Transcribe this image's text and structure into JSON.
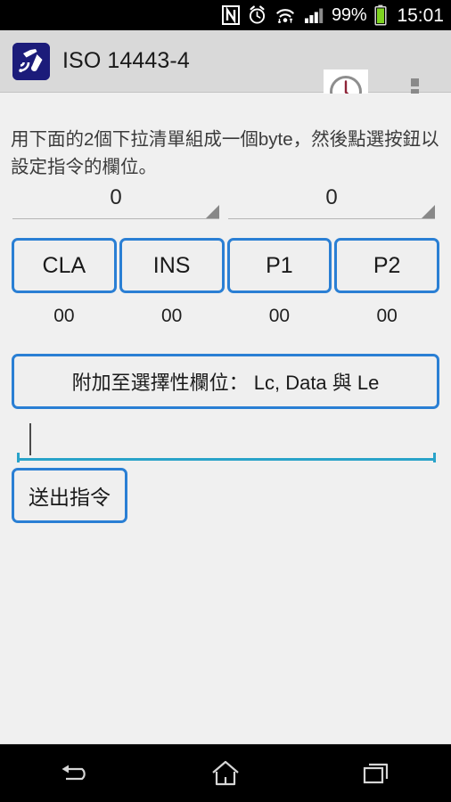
{
  "status_bar": {
    "icons": [
      "nfc-icon",
      "alarm-icon",
      "wifi-icon",
      "signal-icon",
      "battery-icon"
    ],
    "battery_percent": "99%",
    "clock": "15:01"
  },
  "app_bar": {
    "app_icon_name": "nfc-tools-app-icon",
    "title": "ISO 14443-4",
    "clock_action_name": "clock-icon",
    "overflow_name": "overflow-menu-icon"
  },
  "content": {
    "instruction": "用下面的2個下拉清單組成一個byte，然後點選按鈕以設定指令的欄位。",
    "spinners": [
      {
        "name": "spinner-high-nibble",
        "value": "0"
      },
      {
        "name": "spinner-low-nibble",
        "value": "0"
      }
    ],
    "field_buttons": [
      {
        "label": "CLA",
        "value": "00"
      },
      {
        "label": "INS",
        "value": "00"
      },
      {
        "label": "P1",
        "value": "00"
      },
      {
        "label": "P2",
        "value": "00"
      }
    ],
    "optional_fields_label": "附加至選擇性欄位： Lc, Data 與 Le",
    "command_input": {
      "value": "",
      "placeholder": ""
    },
    "send_label": "送出指令"
  },
  "nav_bar": {
    "back": "back-icon",
    "home": "home-icon",
    "recents": "recents-icon"
  },
  "colors": {
    "accent_blue": "#2a7fd4",
    "input_underline": "#29a3c9",
    "app_icon_bg": "#1c1c7a",
    "app_bar_bg": "#d9d9d9",
    "content_bg": "#f0f0f0",
    "battery_green": "#7ed321"
  }
}
